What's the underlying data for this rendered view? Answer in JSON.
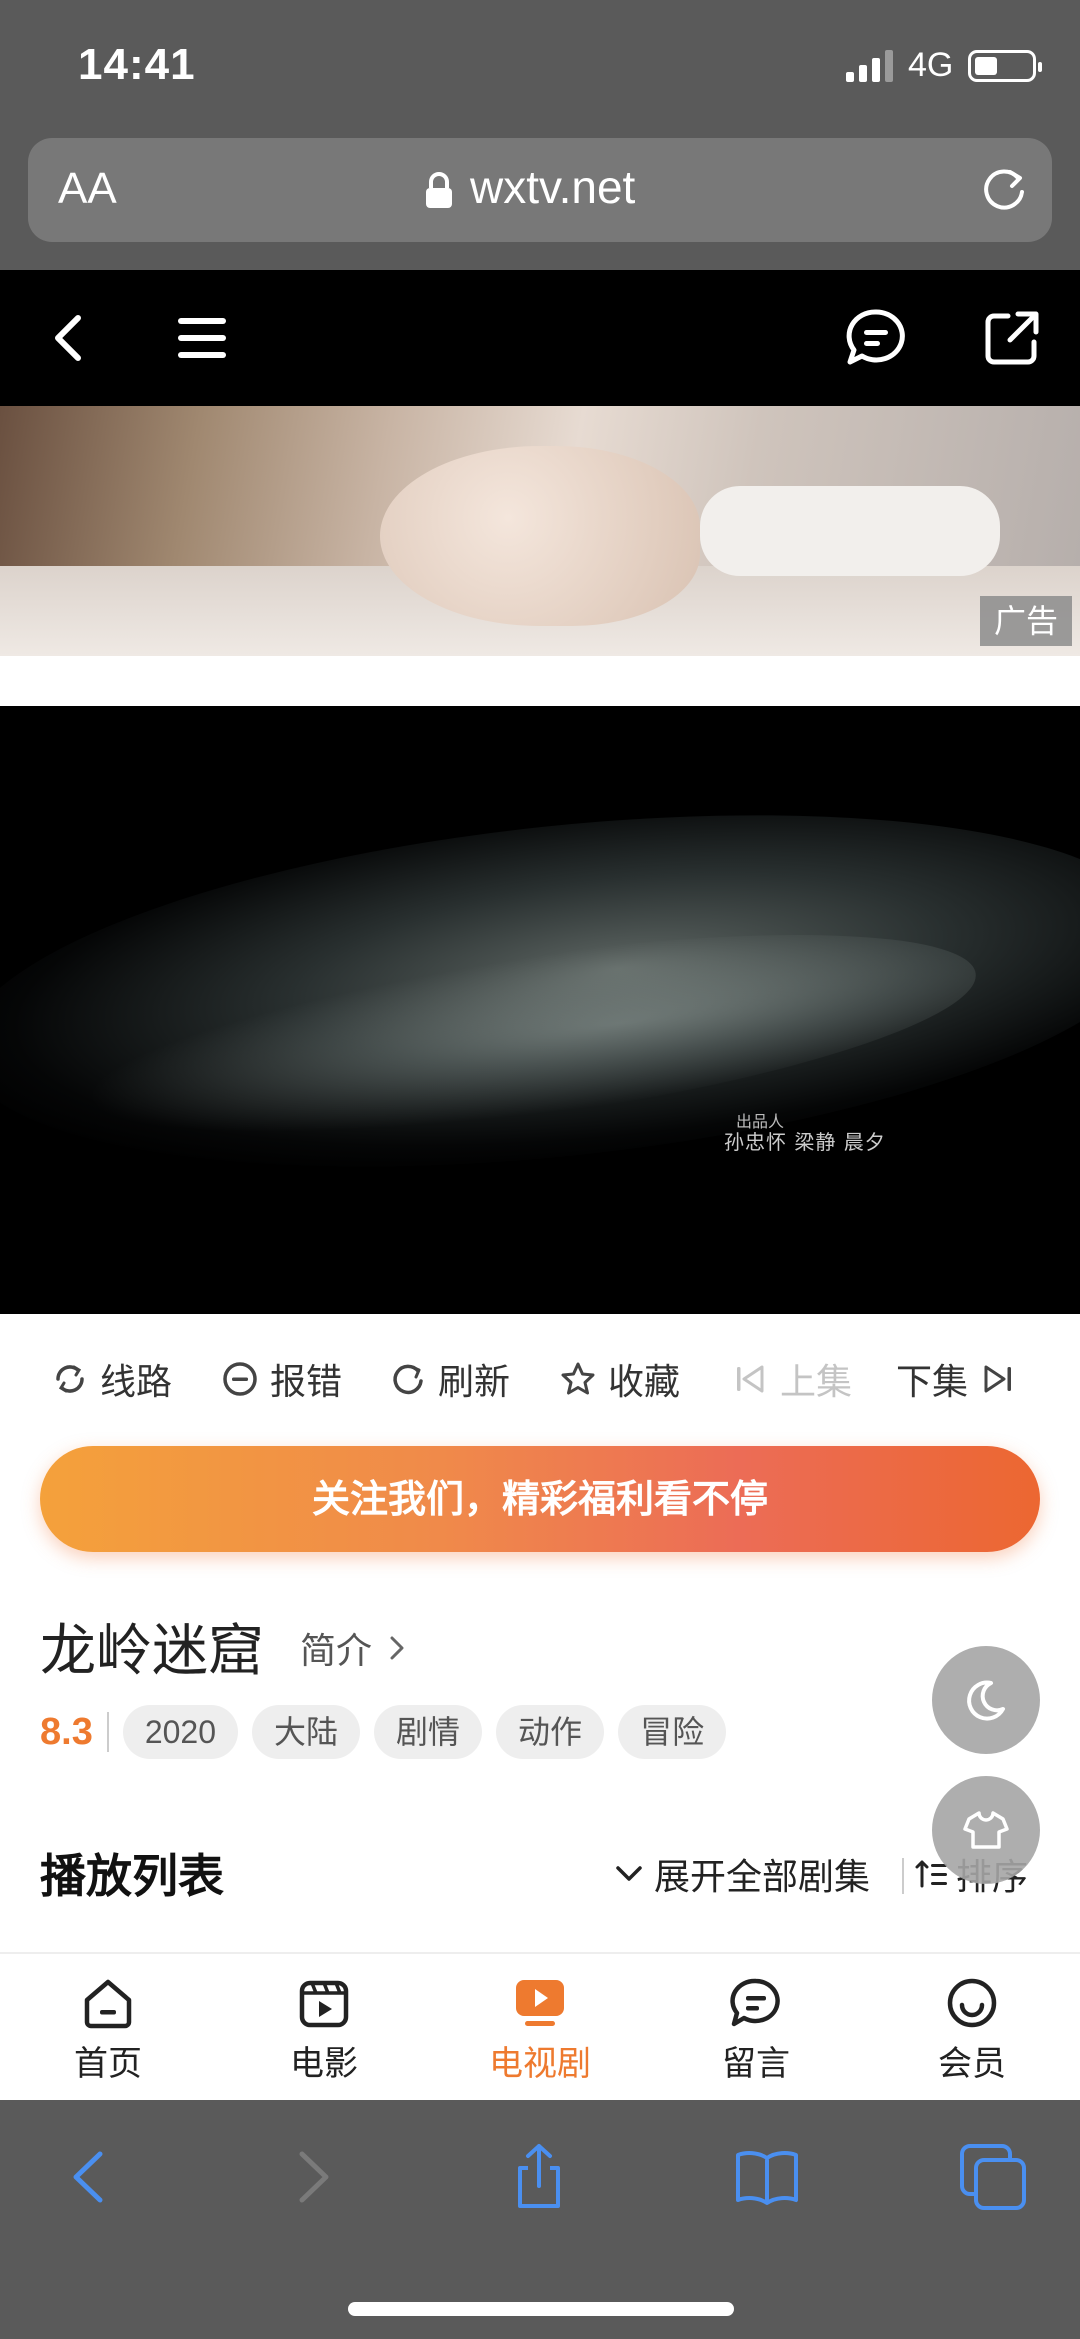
{
  "status_bar": {
    "time": "14:41",
    "network": "4G"
  },
  "url_bar": {
    "text_size_label": "AA",
    "domain": "wxtv.net"
  },
  "site_header": {
    "icons": [
      "back-icon",
      "menu-icon",
      "message-icon",
      "share-icon"
    ]
  },
  "ad": {
    "badge": "广告"
  },
  "video": {
    "credit_label": "出品人",
    "credit_names": "孙忠怀 梁静 晨夕"
  },
  "actions": {
    "route": "线路",
    "report": "报错",
    "refresh": "刷新",
    "favorite": "收藏",
    "prev_episode": "上集",
    "next_episode": "下集"
  },
  "follow_banner": "关注我们，精彩福利看不停",
  "show": {
    "title": "龙岭迷窟",
    "intro_label": "简介",
    "score": "8.3",
    "tags": [
      "2020",
      "大陆",
      "剧情",
      "动作",
      "冒险"
    ]
  },
  "playlist": {
    "title": "播放列表",
    "expand_label": "展开全部剧集",
    "sort_label": "排序"
  },
  "tabbar": {
    "items": [
      {
        "label": "首页",
        "icon": "home-icon"
      },
      {
        "label": "电影",
        "icon": "film-icon"
      },
      {
        "label": "电视剧",
        "icon": "tv-icon",
        "active": true
      },
      {
        "label": "留言",
        "icon": "message-icon"
      },
      {
        "label": "会员",
        "icon": "member-icon"
      }
    ]
  },
  "colors": {
    "accent": "#ee7a2f",
    "safari_blue": "#4a8ff0"
  }
}
